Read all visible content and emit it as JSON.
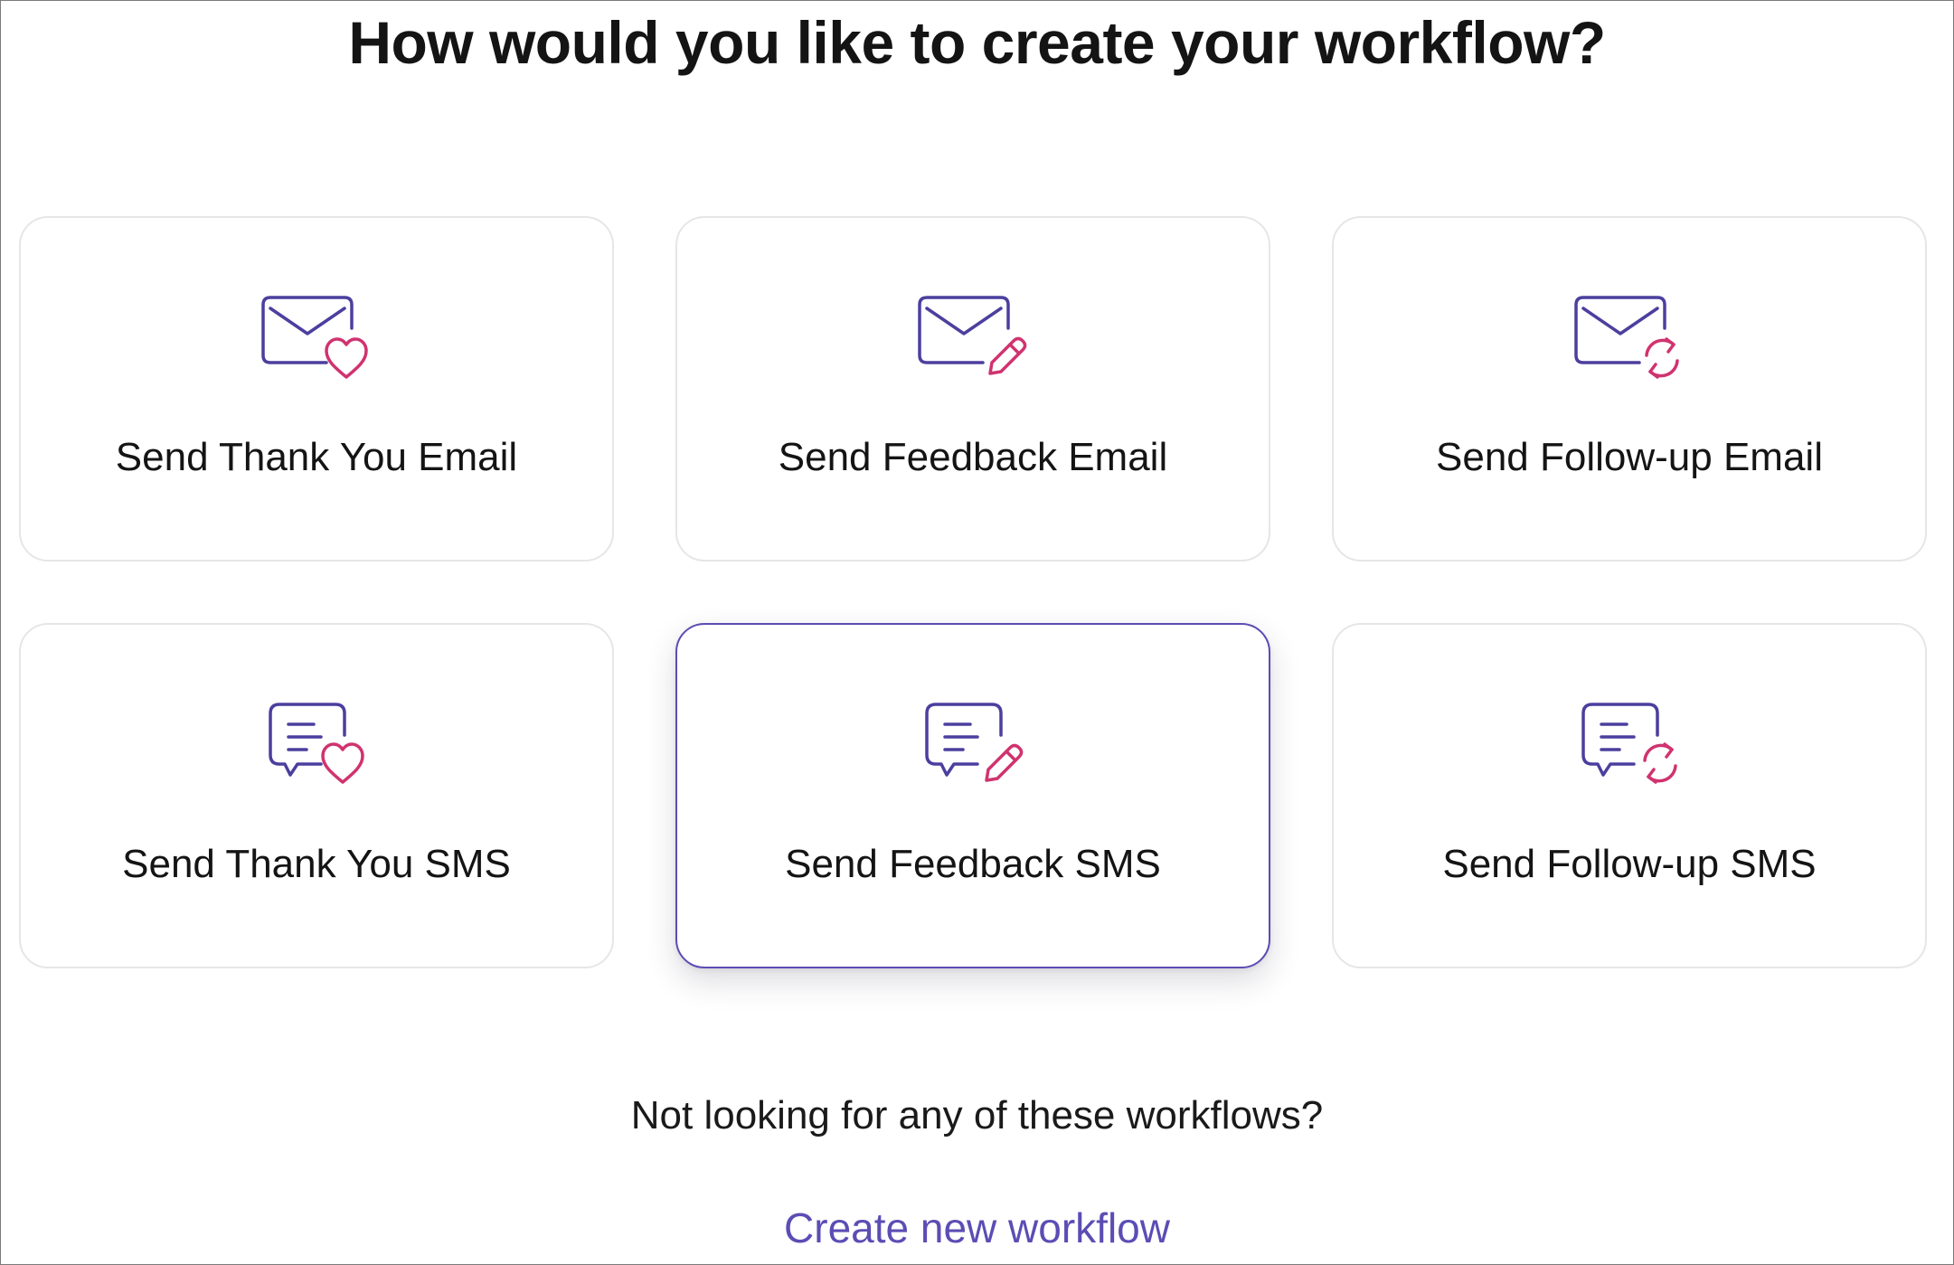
{
  "page_title": "How would you like to create your workflow?",
  "colors": {
    "accent": "#5b4db4",
    "icon_primary": "#4b3f9e",
    "icon_secondary": "#d0336f",
    "card_border": "#e6e6e9"
  },
  "cards": [
    {
      "label": "Send Thank You Email",
      "icon": "mail-heart-icon",
      "selected": false
    },
    {
      "label": "Send Feedback Email",
      "icon": "mail-pencil-icon",
      "selected": false
    },
    {
      "label": "Send Follow-up Email",
      "icon": "mail-refresh-icon",
      "selected": false
    },
    {
      "label": "Send Thank You SMS",
      "icon": "sms-heart-icon",
      "selected": false
    },
    {
      "label": "Send Feedback SMS",
      "icon": "sms-pencil-icon",
      "selected": true
    },
    {
      "label": "Send Follow-up SMS",
      "icon": "sms-refresh-icon",
      "selected": false
    }
  ],
  "footer": {
    "question": "Not looking for any of these workflows?",
    "create_link": "Create new workflow"
  }
}
